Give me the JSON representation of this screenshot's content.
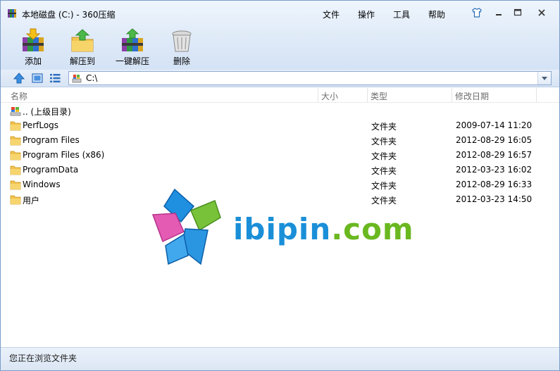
{
  "window": {
    "title": "本地磁盘 (C:) - 360压缩"
  },
  "menu": {
    "items": [
      "文件",
      "操作",
      "工具",
      "帮助"
    ]
  },
  "toolbar": {
    "add": "添加",
    "extract_to": "解压到",
    "one_click_extract": "一键解压",
    "delete": "删除"
  },
  "address": {
    "path": "C:\\"
  },
  "columns": {
    "name": "名称",
    "size": "大小",
    "type": "类型",
    "modified": "修改日期"
  },
  "files": [
    {
      "name": ".. (上级目录)",
      "type": "",
      "date": "",
      "icon": "parent-folder-icon"
    },
    {
      "name": "PerfLogs",
      "type": "文件夹",
      "date": "2009-07-14 11:20",
      "icon": "folder-icon"
    },
    {
      "name": "Program Files",
      "type": "文件夹",
      "date": "2012-08-29 16:05",
      "icon": "folder-icon"
    },
    {
      "name": "Program Files (x86)",
      "type": "文件夹",
      "date": "2012-08-29 16:57",
      "icon": "folder-icon"
    },
    {
      "name": "ProgramData",
      "type": "文件夹",
      "date": "2012-03-23 16:02",
      "icon": "folder-icon"
    },
    {
      "name": "Windows",
      "type": "文件夹",
      "date": "2012-08-29 16:33",
      "icon": "folder-icon"
    },
    {
      "name": "用户",
      "type": "文件夹",
      "date": "2012-03-23 14:50",
      "icon": "folder-icon"
    }
  ],
  "status": {
    "text": "您正在浏览文件夹"
  },
  "watermark": {
    "left": "ibipin",
    "right": ".com"
  },
  "colors": {
    "accent": "#d3e2f5",
    "watermark_blue": "#1a8fd8",
    "watermark_green": "#6ab820",
    "folder": "#f1c24e"
  }
}
